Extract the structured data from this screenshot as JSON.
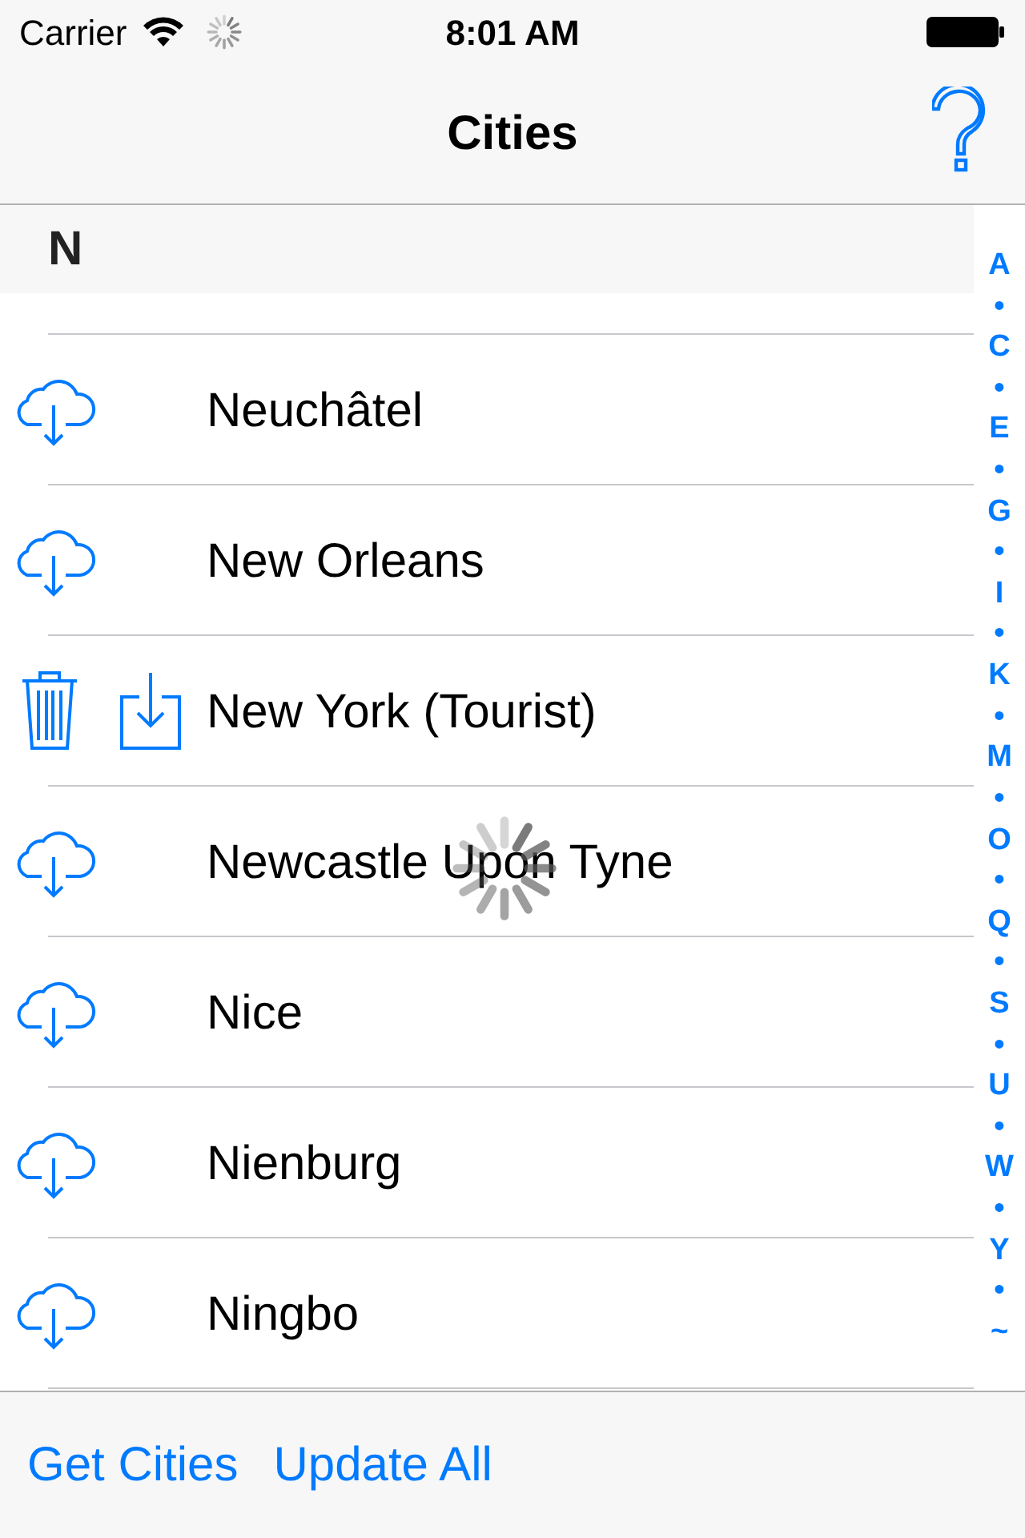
{
  "status_bar": {
    "carrier": "Carrier",
    "time": "8:01 AM"
  },
  "nav": {
    "title": "Cities"
  },
  "section": {
    "header": "N"
  },
  "rows": [
    {
      "name": "Neuchâtel",
      "kind": "cloud",
      "loading": false
    },
    {
      "name": "New Orleans",
      "kind": "cloud",
      "loading": false
    },
    {
      "name": "New York (Tourist)",
      "kind": "stored",
      "loading": false
    },
    {
      "name": "Newcastle Upon Tyne",
      "kind": "cloud",
      "loading": true
    },
    {
      "name": "Nice",
      "kind": "cloud",
      "loading": false
    },
    {
      "name": "Nienburg",
      "kind": "cloud",
      "loading": false
    },
    {
      "name": "Ningbo",
      "kind": "cloud",
      "loading": false
    }
  ],
  "index": [
    "A",
    "•",
    "C",
    "•",
    "E",
    "•",
    "G",
    "•",
    "I",
    "•",
    "K",
    "•",
    "M",
    "•",
    "O",
    "•",
    "Q",
    "•",
    "S",
    "•",
    "U",
    "•",
    "W",
    "•",
    "Y",
    "•",
    "~"
  ],
  "toolbar": [
    "Get Cities",
    "Update All"
  ]
}
